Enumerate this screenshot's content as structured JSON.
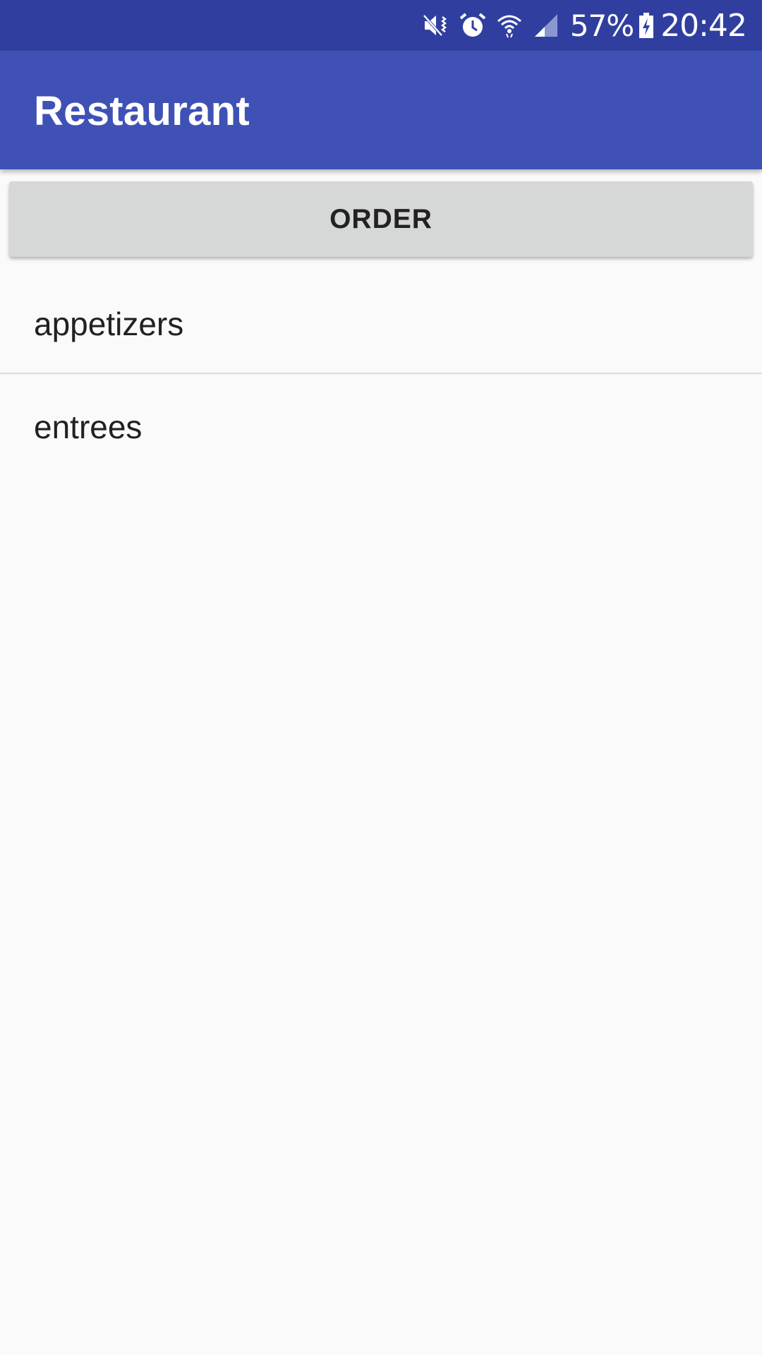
{
  "status_bar": {
    "battery_percent": "57%",
    "time": "20:42",
    "icons": [
      "mute-vibrate-icon",
      "alarm-icon",
      "wifi-icon",
      "signal-icon",
      "battery-charging-icon"
    ],
    "background_color": "#303f9f"
  },
  "app_bar": {
    "title": "Restaurant",
    "background_color": "#3f51b5"
  },
  "order_button": {
    "label": "ORDER"
  },
  "menu": {
    "items": [
      {
        "label": "appetizers"
      },
      {
        "label": "entrees"
      }
    ]
  }
}
